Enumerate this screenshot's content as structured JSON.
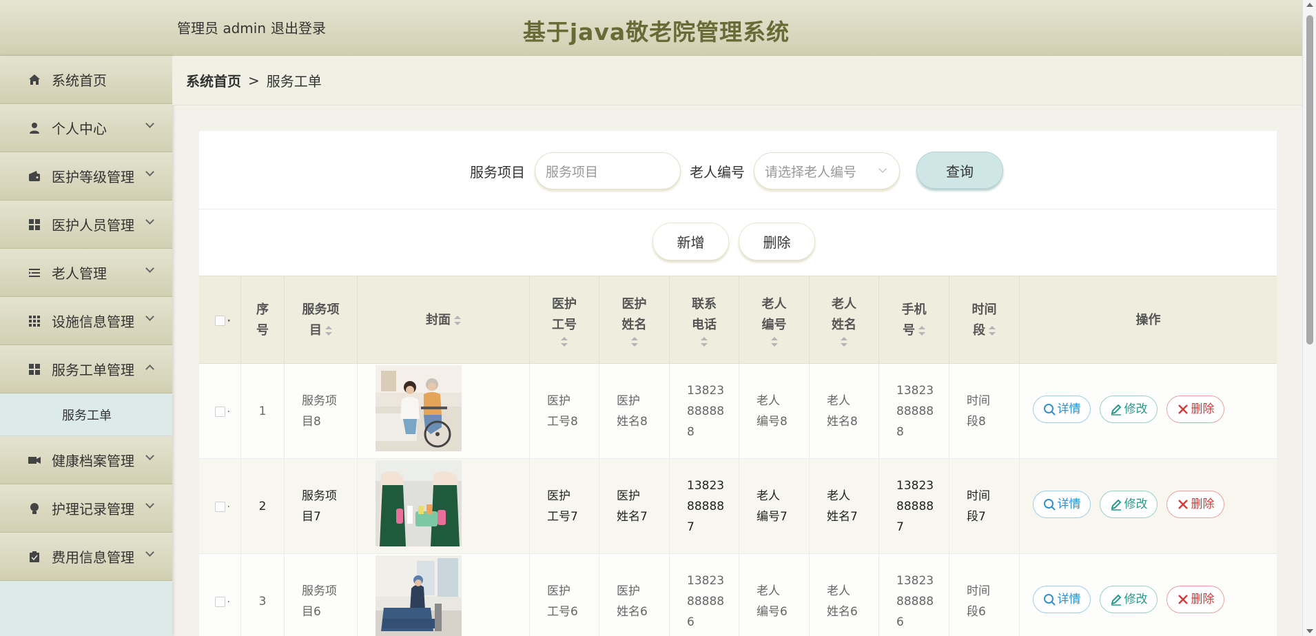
{
  "header": {
    "user_text": "管理员 admin",
    "logout_label": "退出登录",
    "title": "基于java敬老院管理系统"
  },
  "sidebar": {
    "items": [
      {
        "label": "系统首页",
        "icon": "home-icon",
        "has_chevron": false
      },
      {
        "label": "个人中心",
        "icon": "user-icon",
        "has_chevron": true
      },
      {
        "label": "医护等级管理",
        "icon": "wallet-icon",
        "has_chevron": true
      },
      {
        "label": "医护人员管理",
        "icon": "grid-icon",
        "has_chevron": true
      },
      {
        "label": "老人管理",
        "icon": "list-icon",
        "has_chevron": true
      },
      {
        "label": "设施信息管理",
        "icon": "apps-icon",
        "has_chevron": true
      },
      {
        "label": "服务工单管理",
        "icon": "grid-icon",
        "has_chevron": true,
        "expanded": true
      }
    ],
    "sub_item": "服务工单",
    "items_after": [
      {
        "label": "健康档案管理",
        "icon": "ticket-icon"
      },
      {
        "label": "护理记录管理",
        "icon": "bulb-icon"
      },
      {
        "label": "费用信息管理",
        "icon": "clipboard-icon"
      }
    ]
  },
  "breadcrumb": {
    "home": "系统首页",
    "separator": ">",
    "current": "服务工单"
  },
  "search": {
    "service_label": "服务项目",
    "service_placeholder": "服务项目",
    "elder_label": "老人编号",
    "elder_placeholder": "请选择老人编号",
    "query_label": "查询"
  },
  "actions": {
    "add_label": "新增",
    "delete_label": "删除"
  },
  "table": {
    "headers": {
      "index": [
        "序",
        "号"
      ],
      "service": [
        "服务项",
        "目"
      ],
      "cover": "封面",
      "nurse_no": [
        "医护",
        "工号"
      ],
      "nurse_name": [
        "医护",
        "姓名"
      ],
      "contact": [
        "联系",
        "电话"
      ],
      "elder_no": [
        "老人",
        "编号"
      ],
      "elder_name": [
        "老人",
        "姓名"
      ],
      "phone": [
        "手机",
        "号"
      ],
      "period": [
        "时间",
        "段"
      ],
      "ops": "操作"
    },
    "rows": [
      {
        "index": "1",
        "service": [
          "服务项",
          "目8"
        ],
        "nurse_no": [
          "医护",
          "工号8"
        ],
        "nurse_name": [
          "医护",
          "姓名8"
        ],
        "contact": [
          "13823",
          "88888",
          "8"
        ],
        "elder_no": [
          "老人",
          "编号8"
        ],
        "elder_name": [
          "老人",
          "姓名8"
        ],
        "phone": [
          "13823",
          "88888",
          "8"
        ],
        "period": [
          "时间",
          "段8"
        ],
        "cover": "caregiver-wheelchair"
      },
      {
        "index": "2",
        "service": [
          "服务项",
          "目7"
        ],
        "nurse_no": [
          "医护",
          "工号7"
        ],
        "nurse_name": [
          "医护",
          "姓名7"
        ],
        "contact": [
          "13823",
          "88888",
          "7"
        ],
        "elder_no": [
          "老人",
          "编号7"
        ],
        "elder_name": [
          "老人",
          "姓名7"
        ],
        "phone": [
          "13823",
          "88888",
          "7"
        ],
        "period": [
          "时间",
          "段7"
        ],
        "cover": "cleaning-staff"
      },
      {
        "index": "3",
        "service": [
          "服务项",
          "目6"
        ],
        "nurse_no": [
          "医护",
          "工号6"
        ],
        "nurse_name": [
          "医护",
          "姓名6"
        ],
        "contact": [
          "13823",
          "88888",
          "6"
        ],
        "elder_no": [
          "老人",
          "编号6"
        ],
        "elder_name": [
          "老人",
          "姓名6"
        ],
        "phone": [
          "13823",
          "88888",
          "6"
        ],
        "period": [
          "时间",
          "段6"
        ],
        "cover": "housekeeping-sofa"
      }
    ],
    "op_labels": {
      "detail": "详情",
      "edit": "修改",
      "delete": "删除"
    }
  },
  "colors": {
    "header_bg": "#d9d7bd",
    "title_text": "#6a6a36",
    "sidebar_active_bg": "#dcebea",
    "query_btn_bg": "#cfe6e6",
    "detail": "#2f8fd0",
    "edit": "#27998a",
    "delete": "#d23a3a"
  }
}
